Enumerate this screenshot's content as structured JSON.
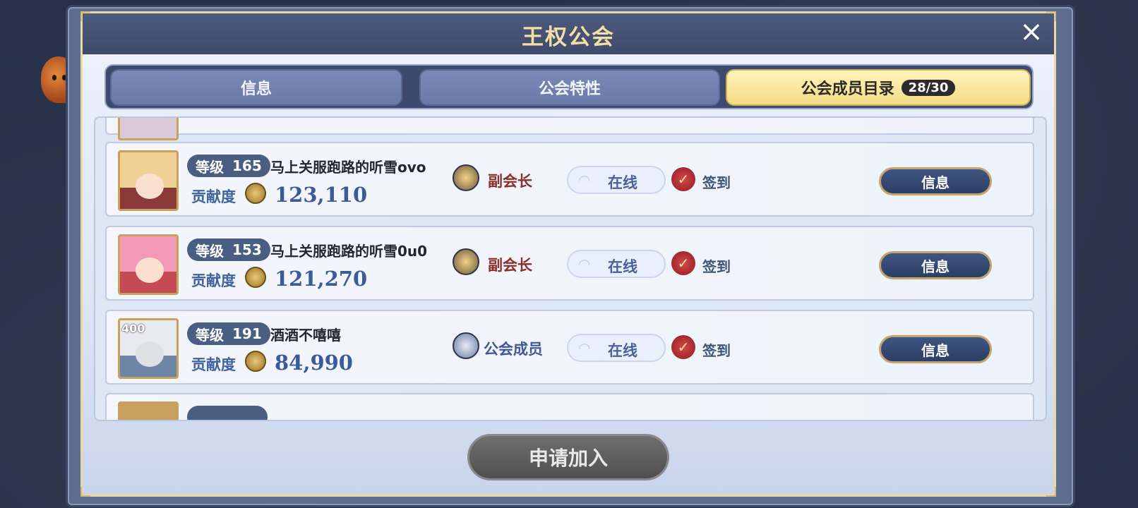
{
  "dialog": {
    "title": "王权公会",
    "close_icon": "×"
  },
  "tabs": [
    {
      "label": "信息",
      "active": false
    },
    {
      "label": "公会特性",
      "active": false
    },
    {
      "label": "公会成员目录",
      "count": "28/30",
      "active": true
    }
  ],
  "members": [
    {
      "level_label": "等级",
      "level": "165",
      "name": "马上关服跑路的听雪ovo",
      "contrib_label": "贡献度",
      "contribution": "123,110",
      "rank": "副会长",
      "rank_icon": "vice-leader-badge-icon",
      "status": "在线",
      "signin": "签到",
      "info_button": "信息",
      "avatar_colors": {
        "hair": "#f0d197",
        "bg": "#8b3a3a"
      }
    },
    {
      "level_label": "等级",
      "level": "153",
      "name": "马上关服跑路的听雪0u0",
      "contrib_label": "贡献度",
      "contribution": "121,270",
      "rank": "副会长",
      "rank_icon": "vice-leader-badge-icon",
      "status": "在线",
      "signin": "签到",
      "info_button": "信息",
      "avatar_colors": {
        "hair": "#f29ab8",
        "bg": "#c44a56"
      }
    },
    {
      "level_label": "等级",
      "level": "191",
      "name": "酒酒不嘻嘻",
      "contrib_label": "贡献度",
      "contribution": "84,990",
      "rank": "公会成员",
      "rank_icon": "member-badge-icon",
      "status": "在线",
      "signin": "签到",
      "info_button": "信息",
      "avatar_tag": "400",
      "avatar_colors": {
        "hair": "#e9eaef",
        "bg": "#6d86a6"
      }
    }
  ],
  "apply_button": "申请加入",
  "colors": {
    "accent_gold": "#f3dfa6",
    "tab_active": "#f5dc86",
    "button_dark": "#2c3f66",
    "vice_rank": "#8a2f2a"
  }
}
